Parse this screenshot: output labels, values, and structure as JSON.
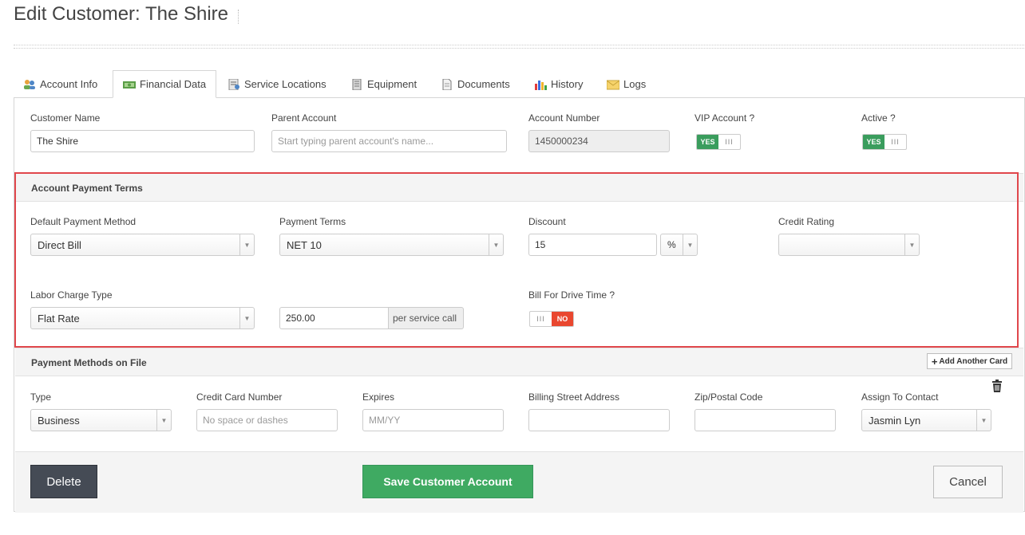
{
  "page": {
    "title": "Edit Customer: The Shire"
  },
  "tabs": [
    {
      "label": "Account Info",
      "icon": "users-icon"
    },
    {
      "label": "Financial Data",
      "icon": "money-icon"
    },
    {
      "label": "Service Locations",
      "icon": "location-list-icon"
    },
    {
      "label": "Equipment",
      "icon": "equipment-icon"
    },
    {
      "label": "Documents",
      "icon": "document-icon"
    },
    {
      "label": "History",
      "icon": "bar-chart-icon"
    },
    {
      "label": "Logs",
      "icon": "envelope-icon"
    }
  ],
  "active_tab": "Financial Data",
  "customer": {
    "name_label": "Customer Name",
    "name_value": "The Shire",
    "parent_label": "Parent Account",
    "parent_placeholder": "Start typing parent account's name...",
    "account_number_label": "Account Number",
    "account_number_value": "1450000234",
    "vip_label": "VIP Account ?",
    "vip_on": "YES",
    "vip_handle": "III",
    "active_label": "Active ?",
    "active_on": "YES",
    "active_handle": "III"
  },
  "payment_terms": {
    "section_title": "Account Payment Terms",
    "default_method_label": "Default Payment Method",
    "default_method_value": "Direct Bill",
    "terms_label": "Payment Terms",
    "terms_value": "NET 10",
    "discount_label": "Discount",
    "discount_value": "15",
    "discount_unit": "%",
    "credit_rating_label": "Credit Rating",
    "credit_rating_value": "",
    "labor_type_label": "Labor Charge Type",
    "labor_type_value": "Flat Rate",
    "labor_rate_value": "250.00",
    "labor_rate_suffix": "per service call",
    "drive_time_label": "Bill For Drive Time ?",
    "drive_time_handle": "III",
    "drive_time_off": "NO"
  },
  "payment_methods": {
    "section_title": "Payment Methods on File",
    "add_card_label": "Add Another Card",
    "type_label": "Type",
    "type_value": "Business",
    "card_label": "Credit Card Number",
    "card_placeholder": "No space or dashes",
    "expires_label": "Expires",
    "expires_placeholder": "MM/YY",
    "street_label": "Billing Street Address",
    "zip_label": "Zip/Postal Code",
    "contact_label": "Assign To Contact",
    "contact_value": "Jasmin Lyn"
  },
  "actions": {
    "delete_label": "Delete",
    "save_label": "Save Customer Account",
    "cancel_label": "Cancel"
  },
  "colors": {
    "save_green": "#3faa62",
    "toggle_yes": "#3a9d5d",
    "toggle_no": "#e9472f",
    "delete_dark": "#454b55",
    "highlight_red": "#e0474c"
  }
}
